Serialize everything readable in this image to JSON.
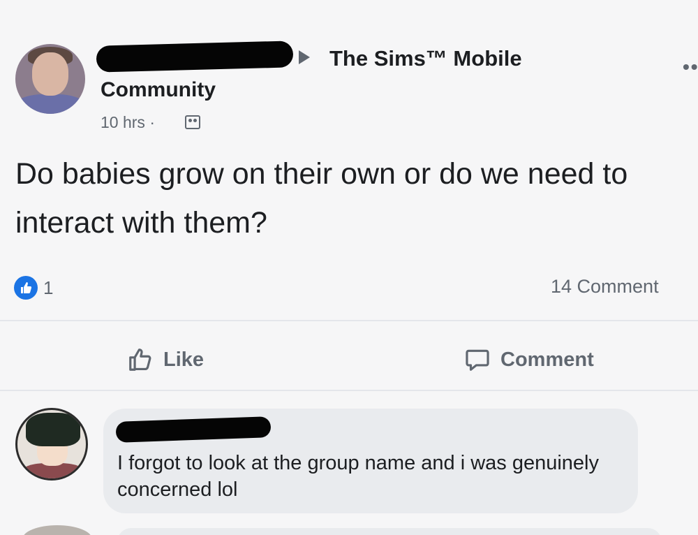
{
  "post": {
    "arrow_icon": "caret-right-icon",
    "group_name": "The Sims™ Mobile",
    "community_label": "Community",
    "timestamp": "10 hrs ·",
    "privacy_icon": "group-icon",
    "more_icon": "more-dots-icon",
    "more_text": "••",
    "text": "Do babies grow on their own or do we need to interact with them?",
    "reactions": {
      "icon": "like-reaction-icon",
      "count": "1"
    },
    "comments_count": "14 Comment"
  },
  "actions": {
    "like_label": "Like",
    "like_icon": "thumbs-up-icon",
    "comment_label": "Comment",
    "comment_icon": "speech-bubble-icon"
  },
  "comment": {
    "text": "I forgot to look at the group name and i was genuinely concerned lol"
  },
  "colors": {
    "accent": "#1b74e4",
    "text": "#1c1e21",
    "secondary_text": "#606770",
    "bubble": "#e9ebee"
  }
}
